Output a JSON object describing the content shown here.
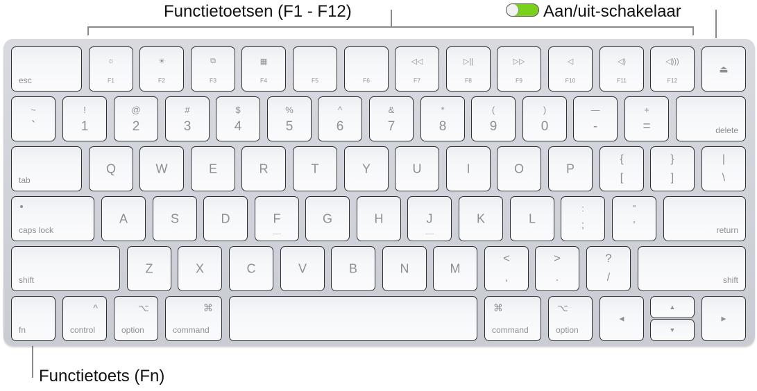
{
  "callouts": {
    "function_keys": "Functietoetsen (F1 - F12)",
    "power_switch": "Aan/uit-schakelaar",
    "fn_key": "Functietoets (Fn)"
  },
  "toggle": {
    "state": "on",
    "color": "#7ad11d"
  },
  "keys": {
    "esc": "esc",
    "function_row": [
      {
        "icon": "☼",
        "label": "F1",
        "icon_name": "brightness-down-icon"
      },
      {
        "icon": "☀",
        "label": "F2",
        "icon_name": "brightness-up-icon"
      },
      {
        "icon": "⧉",
        "label": "F3",
        "icon_name": "mission-control-icon"
      },
      {
        "icon": "▦",
        "label": "F4",
        "icon_name": "launchpad-icon"
      },
      {
        "icon": "",
        "label": "F5",
        "icon_name": ""
      },
      {
        "icon": "",
        "label": "F6",
        "icon_name": ""
      },
      {
        "icon": "◁◁",
        "label": "F7",
        "icon_name": "rewind-icon"
      },
      {
        "icon": "▷||",
        "label": "F8",
        "icon_name": "play-pause-icon"
      },
      {
        "icon": "▷▷",
        "label": "F9",
        "icon_name": "fast-forward-icon"
      },
      {
        "icon": "◁",
        "label": "F10",
        "icon_name": "mute-icon"
      },
      {
        "icon": "◁)",
        "label": "F11",
        "icon_name": "volume-down-icon"
      },
      {
        "icon": "◁)))",
        "label": "F12",
        "icon_name": "volume-up-icon"
      }
    ],
    "eject_icon": "⏏",
    "number_row": [
      {
        "top": "~",
        "bot": "`"
      },
      {
        "top": "!",
        "bot": "1"
      },
      {
        "top": "@",
        "bot": "2"
      },
      {
        "top": "#",
        "bot": "3"
      },
      {
        "top": "$",
        "bot": "4"
      },
      {
        "top": "%",
        "bot": "5"
      },
      {
        "top": "^",
        "bot": "6"
      },
      {
        "top": "&",
        "bot": "7"
      },
      {
        "top": "*",
        "bot": "8"
      },
      {
        "top": "(",
        "bot": "9"
      },
      {
        "top": ")",
        "bot": "0"
      },
      {
        "top": "—",
        "bot": "-"
      },
      {
        "top": "+",
        "bot": "="
      }
    ],
    "delete": "delete",
    "tab": "tab",
    "qwerty_row": [
      "Q",
      "W",
      "E",
      "R",
      "T",
      "Y",
      "U",
      "I",
      "O",
      "P"
    ],
    "bracket_row": [
      {
        "top": "{",
        "bot": "["
      },
      {
        "top": "}",
        "bot": "]"
      },
      {
        "top": "|",
        "bot": "\\"
      }
    ],
    "caps_lock": "caps lock",
    "home_row": [
      "A",
      "S",
      "D",
      "F",
      "G",
      "H",
      "J",
      "K",
      "L"
    ],
    "home_punct": [
      {
        "top": ":",
        "bot": ";"
      },
      {
        "top": "\"",
        "bot": "'"
      }
    ],
    "return": "return",
    "shift": "shift",
    "bottom_letters": [
      "Z",
      "X",
      "C",
      "V",
      "B",
      "N",
      "M"
    ],
    "bottom_punct": [
      {
        "top": "<",
        "bot": ","
      },
      {
        "top": ">",
        "bot": "."
      },
      {
        "top": "?",
        "bot": "/"
      }
    ],
    "fn": "fn",
    "control": "control",
    "control_symbol": "^",
    "option": "option",
    "option_symbol": "⌥",
    "command": "command",
    "command_symbol": "⌘",
    "arrow_left": "◀",
    "arrow_up": "▲",
    "arrow_down": "▼",
    "arrow_right": "▶"
  }
}
